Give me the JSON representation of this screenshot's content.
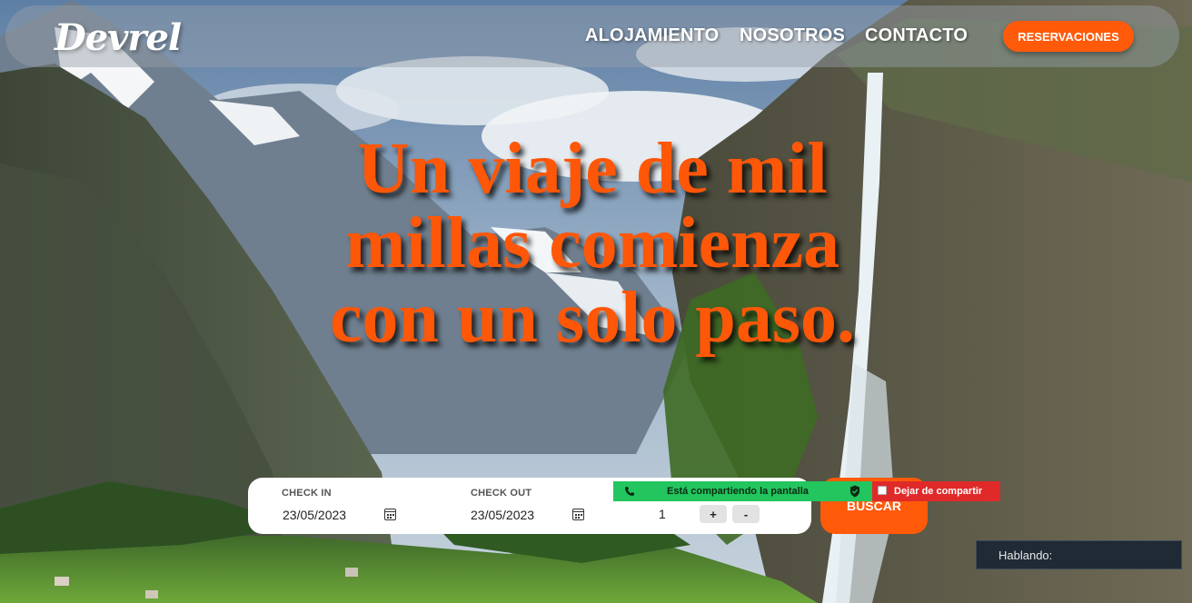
{
  "brand": {
    "logo": "Devrel"
  },
  "nav": {
    "links": [
      "ALOJAMIENTO",
      "NOSOTROS",
      "CONTACTO"
    ],
    "cta": "RESERVACIONES"
  },
  "hero": {
    "headline": "Un viaje de mil millas comienza con un solo paso."
  },
  "booking": {
    "check_in_label": "CHECK IN",
    "check_in_value": "23/05/2023",
    "check_out_label": "CHECK OUT",
    "check_out_value": "23/05/2023",
    "guests_value": "1",
    "plus_label": "+",
    "minus_label": "-",
    "search_label": "BUSCAR",
    "calendar_icon": "calendar-icon"
  },
  "screen_share": {
    "status": "Está compartiendo la pantalla",
    "stop_label": "Dejar de compartir",
    "status_color": "#22c55e",
    "stop_color": "#e02a2a"
  },
  "speaking": {
    "label": "Hablando:"
  },
  "colors": {
    "accent": "#ff5708",
    "white": "#ffffff"
  }
}
